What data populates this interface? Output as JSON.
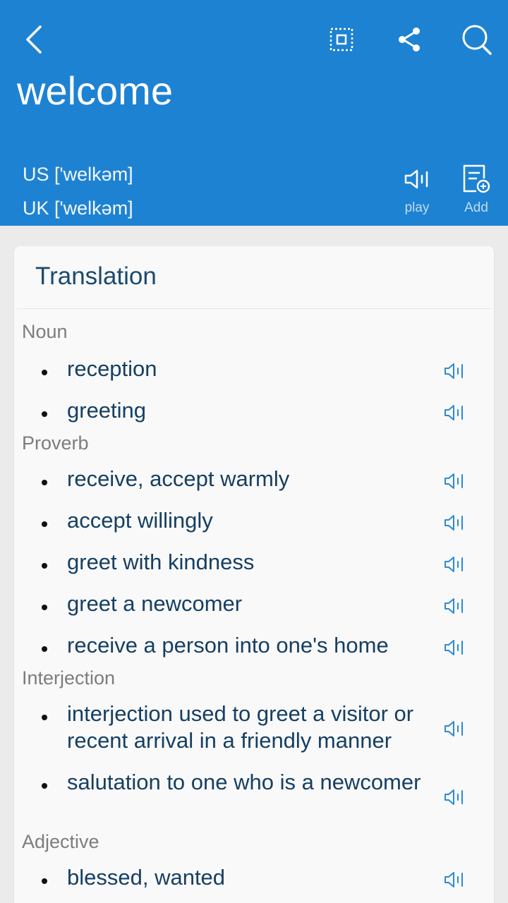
{
  "header": {
    "word": "welcome",
    "pron_us": "US ['welkəm]",
    "pron_uk": "UK ['welkəm]",
    "play_label": "play",
    "add_label": "Add",
    "bg_color": "#1e82d2"
  },
  "icons": {
    "back": "back-arrow-icon",
    "fullscreen": "fullscreen-icon",
    "share": "share-icon",
    "search": "search-icon",
    "play": "speaker-icon",
    "add": "add-to-wordbook-icon"
  },
  "card": {
    "title": "Translation",
    "sections": [
      {
        "pos": "Noun",
        "items": [
          "reception",
          "greeting"
        ]
      },
      {
        "pos": "Proverb",
        "items": [
          "receive, accept warmly",
          "accept willingly",
          "greet with kindness",
          "greet a newcomer",
          "receive a person into one's home"
        ]
      },
      {
        "pos": "Interjection",
        "items": [
          "interjection used to greet a visitor or recent arrival in a friendly manner",
          "salutation to one who is a newcomer"
        ]
      },
      {
        "pos": "Adjective",
        "items": [
          "blessed, wanted"
        ]
      }
    ]
  }
}
